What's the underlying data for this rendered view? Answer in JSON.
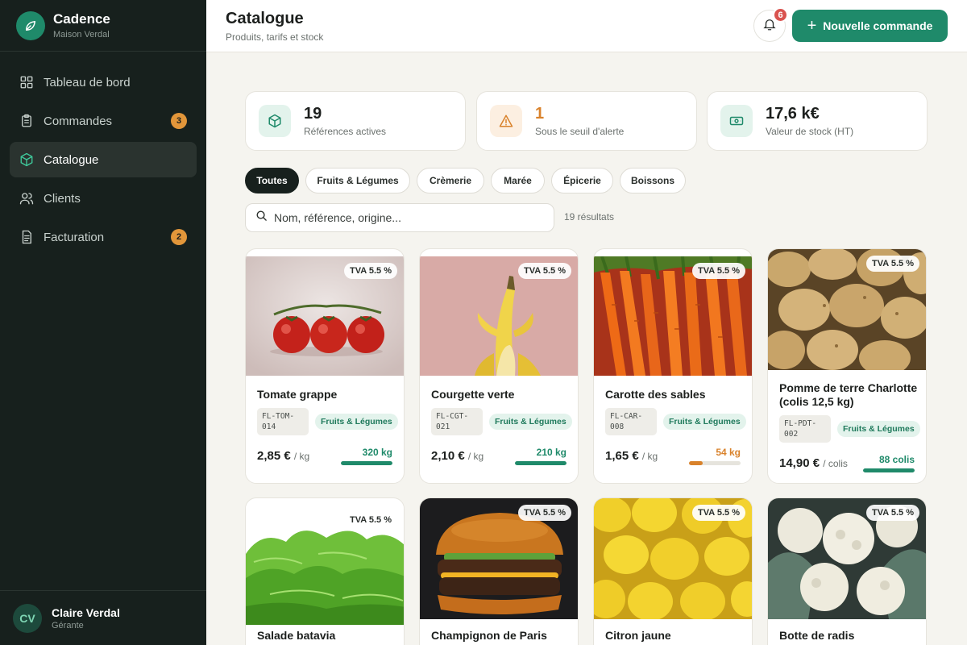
{
  "app": {
    "name": "Cadence",
    "subtitle": "Maison Verdal"
  },
  "sidebar": {
    "items": [
      {
        "label": "Tableau de bord",
        "icon": "dashboard-icon"
      },
      {
        "label": "Commandes",
        "icon": "clipboard-icon",
        "badge": "3"
      },
      {
        "label": "Catalogue",
        "icon": "box-icon",
        "active": true
      },
      {
        "label": "Clients",
        "icon": "users-icon"
      },
      {
        "label": "Facturation",
        "icon": "invoice-icon",
        "badge": "2"
      }
    ]
  },
  "user": {
    "initials": "CV",
    "name": "Claire Verdal",
    "role": "Gérante"
  },
  "header": {
    "title": "Catalogue",
    "subtitle": "Produits, tarifs et stock",
    "notifications": "6",
    "new_order_label": "Nouvelle commande"
  },
  "stats": [
    {
      "value": "19",
      "label": "Références actives",
      "icon": "box-icon"
    },
    {
      "value": "1",
      "label": "Sous le seuil d'alerte",
      "icon": "warning-icon"
    },
    {
      "value": "17,6 k€",
      "label": "Valeur de stock (HT)",
      "icon": "banknote-icon"
    }
  ],
  "filters": [
    "Toutes",
    "Fruits & Légumes",
    "Crèmerie",
    "Marée",
    "Épicerie",
    "Boissons"
  ],
  "active_filter": "Toutes",
  "search": {
    "placeholder": "Nom, référence, origine...",
    "results": "19 résultats"
  },
  "products": [
    {
      "name": "Tomate grappe",
      "tva": "TVA 5.5 %",
      "ref_line1": "FL-TOM-",
      "ref_line2": "014",
      "category": "Fruits & Légumes",
      "price": "2,85 €",
      "unit": "/ kg",
      "stock": "320 kg",
      "stock_level": 1.0,
      "status": "ok"
    },
    {
      "name": "Courgette verte",
      "tva": "TVA 5.5 %",
      "ref_line1": "FL-CGT-",
      "ref_line2": "021",
      "category": "Fruits & Légumes",
      "price": "2,10 €",
      "unit": "/ kg",
      "stock": "210 kg",
      "stock_level": 1.0,
      "status": "ok"
    },
    {
      "name": "Carotte des sables",
      "tva": "TVA 5.5 %",
      "ref_line1": "FL-CAR-",
      "ref_line2": "008",
      "category": "Fruits & Légumes",
      "price": "1,65 €",
      "unit": "/ kg",
      "stock": "54 kg",
      "stock_level": 0.27,
      "status": "low"
    },
    {
      "name": "Pomme de terre Charlotte (colis 12,5 kg)",
      "tva": "TVA 5.5 %",
      "ref_line1": "FL-PDT-",
      "ref_line2": "002",
      "category": "Fruits & Légumes",
      "price": "14,90 €",
      "unit": "/ colis",
      "stock": "88 colis",
      "stock_level": 1.0,
      "status": "ok"
    },
    {
      "name": "Salade batavia",
      "tva": "TVA 5.5 %"
    },
    {
      "name": "Champignon de Paris",
      "tva": "TVA 5.5 %"
    },
    {
      "name": "Citron jaune",
      "tva": "TVA 5.5 %"
    },
    {
      "name": "Botte de radis",
      "tva": "TVA 5.5 %"
    }
  ],
  "colors": {
    "accent": "#1f8a6a",
    "warning": "#d9822b",
    "sidebar": "#17201d",
    "danger": "#d9534f"
  }
}
